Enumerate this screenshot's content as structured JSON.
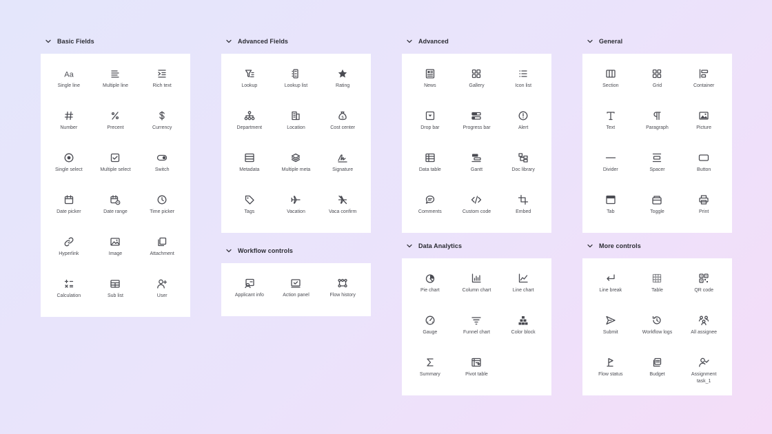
{
  "groups": [
    {
      "id": "basic-fields",
      "title": "Basic Fields",
      "items": [
        {
          "label": "Single line",
          "icon": "text-aa-icon"
        },
        {
          "label": "Multiple line",
          "icon": "lines-icon"
        },
        {
          "label": "Rich text",
          "icon": "indent-icon"
        },
        {
          "label": "Number",
          "icon": "hash-icon"
        },
        {
          "label": "Precent",
          "icon": "percent-icon"
        },
        {
          "label": "Currency",
          "icon": "dollar-icon"
        },
        {
          "label": "Single select",
          "icon": "radio-icon"
        },
        {
          "label": "Multiple select",
          "icon": "checkbox-icon"
        },
        {
          "label": "Switch",
          "icon": "toggle-icon"
        },
        {
          "label": "Date picker",
          "icon": "calendar-icon"
        },
        {
          "label": "Date range",
          "icon": "calendar-clock-icon"
        },
        {
          "label": "Time picker",
          "icon": "clock-icon"
        },
        {
          "label": "Hyperlink",
          "icon": "link-icon"
        },
        {
          "label": "Image",
          "icon": "image-icon"
        },
        {
          "label": "Attachment",
          "icon": "copy-icon"
        },
        {
          "label": "Calculation",
          "icon": "calculator-icon"
        },
        {
          "label": "Sub list",
          "icon": "table-icon"
        },
        {
          "label": "User",
          "icon": "user-add-icon"
        }
      ]
    },
    {
      "id": "advanced-fields",
      "title": "Advanced Fields",
      "items": [
        {
          "label": "Lookup",
          "icon": "filter-icon"
        },
        {
          "label": "Lookup list",
          "icon": "list-box-icon"
        },
        {
          "label": "Rating",
          "icon": "star-icon"
        },
        {
          "label": "Department",
          "icon": "org-icon"
        },
        {
          "label": "Location",
          "icon": "building-icon"
        },
        {
          "label": "Cost center",
          "icon": "money-bag-icon"
        },
        {
          "label": "Metadata",
          "icon": "rows-icon"
        },
        {
          "label": "Multiple meta",
          "icon": "layers-icon"
        },
        {
          "label": "Signature",
          "icon": "signature-icon"
        },
        {
          "label": "Tags",
          "icon": "tag-icon"
        },
        {
          "label": "Vacation",
          "icon": "plane-icon"
        },
        {
          "label": "Vaca confirm",
          "icon": "plane-off-icon"
        }
      ]
    },
    {
      "id": "workflow-controls",
      "title": "Workflow controls",
      "items": [
        {
          "label": "Applicant info",
          "icon": "applicant-icon"
        },
        {
          "label": "Action panel",
          "icon": "action-panel-icon"
        },
        {
          "label": "Flow history",
          "icon": "flow-history-icon"
        }
      ]
    },
    {
      "id": "advanced",
      "title": "Advanced",
      "items": [
        {
          "label": "News",
          "icon": "news-icon"
        },
        {
          "label": "Gallery",
          "icon": "gallery-icon"
        },
        {
          "label": "Icon list",
          "icon": "icon-list-icon"
        },
        {
          "label": "Drop bar",
          "icon": "drop-bar-icon"
        },
        {
          "label": "Progress bar",
          "icon": "progress-bar-icon"
        },
        {
          "label": "Alert",
          "icon": "alert-icon"
        },
        {
          "label": "Data table",
          "icon": "data-table-icon"
        },
        {
          "label": "Gantt",
          "icon": "gantt-icon"
        },
        {
          "label": "Doc library",
          "icon": "doc-library-icon"
        },
        {
          "label": "Comments",
          "icon": "comment-icon"
        },
        {
          "label": "Custom code",
          "icon": "code-icon"
        },
        {
          "label": "Embed",
          "icon": "embed-icon"
        }
      ]
    },
    {
      "id": "data-analytics",
      "title": "Data Analytics",
      "items": [
        {
          "label": "Pie chart",
          "icon": "pie-chart-icon"
        },
        {
          "label": "Column chart",
          "icon": "column-chart-icon"
        },
        {
          "label": "Line chart",
          "icon": "line-chart-icon"
        },
        {
          "label": "Gauge",
          "icon": "gauge-icon"
        },
        {
          "label": "Funnel chart",
          "icon": "funnel-icon"
        },
        {
          "label": "Color block",
          "icon": "color-block-icon"
        },
        {
          "label": "Summary",
          "icon": "sigma-icon"
        },
        {
          "label": "Pivot table",
          "icon": "pivot-table-icon"
        }
      ]
    },
    {
      "id": "general",
      "title": "General",
      "items": [
        {
          "label": "Section",
          "icon": "section-icon"
        },
        {
          "label": "Grid",
          "icon": "grid-icon"
        },
        {
          "label": "Container",
          "icon": "container-icon"
        },
        {
          "label": "Text",
          "icon": "text-t-icon"
        },
        {
          "label": "Paragraph",
          "icon": "pilcrow-icon"
        },
        {
          "label": "Picture",
          "icon": "picture-icon"
        },
        {
          "label": "Divider",
          "icon": "divider-icon"
        },
        {
          "label": "Spacer",
          "icon": "spacer-icon"
        },
        {
          "label": "Button",
          "icon": "button-icon"
        },
        {
          "label": "Tab",
          "icon": "tab-icon"
        },
        {
          "label": "Toggle",
          "icon": "toggle-panel-icon"
        },
        {
          "label": "Print",
          "icon": "printer-icon"
        }
      ]
    },
    {
      "id": "more-controls",
      "title": "More controls",
      "items": [
        {
          "label": "Line break",
          "icon": "line-break-icon"
        },
        {
          "label": "Table",
          "icon": "table-grid-icon"
        },
        {
          "label": "QR code",
          "icon": "qr-code-icon"
        },
        {
          "label": "Submit",
          "icon": "send-icon"
        },
        {
          "label": "Workflow logs",
          "icon": "history-icon"
        },
        {
          "label": "All assignee",
          "icon": "users-icon"
        },
        {
          "label": "Flow status",
          "icon": "flag-icon"
        },
        {
          "label": "Budget",
          "icon": "stack-icon"
        },
        {
          "label": "Assignment\ntask_1",
          "icon": "user-check-icon"
        }
      ]
    }
  ]
}
